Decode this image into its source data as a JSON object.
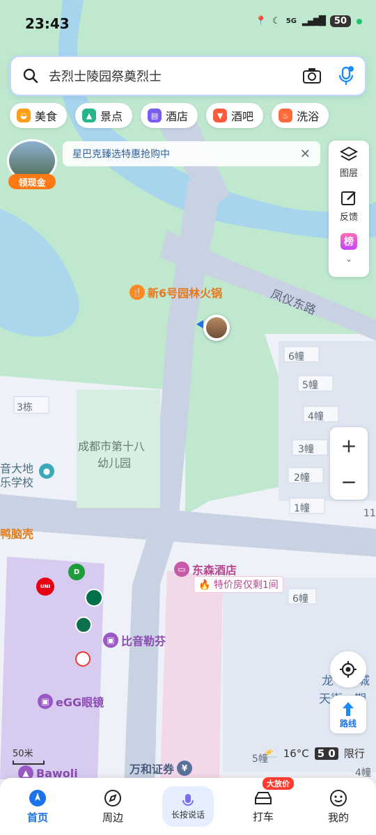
{
  "status": {
    "time": "23:43",
    "battery": "50",
    "network": "5G"
  },
  "search": {
    "query": "去烈士陵园祭奠烈士"
  },
  "chips": [
    "美食",
    "景点",
    "酒店",
    "酒吧",
    "洗浴"
  ],
  "reward": {
    "label": "领现金"
  },
  "banner": {
    "text": "星巴克臻选特惠抢购中"
  },
  "right_panel": {
    "layers": "图层",
    "feedback": "反馈",
    "rank": "榜"
  },
  "map": {
    "roads": [
      "凤仪东路"
    ],
    "pois": {
      "hotpot": "新6号园林火锅",
      "kindergarten_1": "成都市第十八",
      "kindergarten_2": "幼儿园",
      "hotel": "东森酒店",
      "hotel_deal": "特价房仅剩1间",
      "biyin": "比音勒芬",
      "egg": "eGG眼镜",
      "wanhe": "万和证券",
      "bawoli": "Bawoli",
      "duck": "鸭脑壳",
      "school_1": "音大地",
      "school_2": "乐学校",
      "longcheng": "龙",
      "tianjie": "天街一期",
      "cheng": "城"
    },
    "buildings": [
      "6幢",
      "5幢",
      "4幢",
      "3幢",
      "2幢",
      "1幢",
      "3栋",
      "6幢",
      "5幢",
      "4幢",
      "11"
    ]
  },
  "scale": {
    "label": "50米"
  },
  "weather": {
    "temp": "16°C",
    "limit_digits": "5 0",
    "limit_label": "限行"
  },
  "route_label": "路线",
  "nav": {
    "home": "首页",
    "nearby": "周边",
    "voice": "长按说话",
    "taxi": "打车",
    "taxi_badge": "大放价",
    "me": "我的"
  }
}
